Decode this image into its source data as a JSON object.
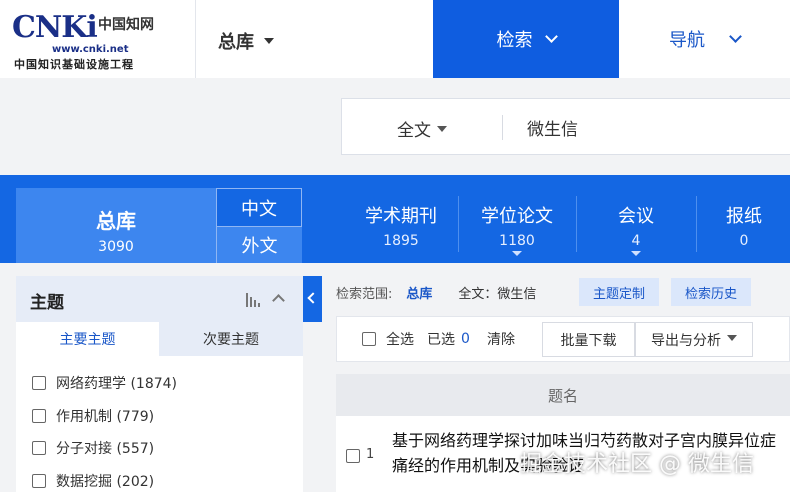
{
  "header": {
    "logo_main": "CNKi",
    "logo_cn": "中国知网",
    "logo_url": "www.cnki.net",
    "logo_sub": "中国知识基础设施工程",
    "library_switch": "总库",
    "search_tab": "检索",
    "nav_tab": "导航"
  },
  "search": {
    "scope": "全文",
    "query": "微生信"
  },
  "categories": {
    "total": {
      "label": "总库",
      "count": "3090"
    },
    "lang_cn": "中文",
    "lang_en": "外文",
    "items": [
      {
        "label": "学术期刊",
        "count": "1895"
      },
      {
        "label": "学位论文",
        "count": "1180"
      },
      {
        "label": "会议",
        "count": "4"
      },
      {
        "label": "报纸",
        "count": "0"
      }
    ]
  },
  "facet": {
    "title": "主题",
    "tab_primary": "主要主题",
    "tab_secondary": "次要主题",
    "items": [
      "网络药理学 (1874)",
      "作用机制 (779)",
      "分子对接 (557)",
      "数据挖掘 (202)"
    ]
  },
  "results": {
    "scope_label": "检索范围:",
    "scope_value": "总库",
    "scope_query": "全文：微生信",
    "custom_btn": "主题定制",
    "history_btn": "检索历史",
    "select_all": "全选",
    "selected_label": "已选",
    "selected_count": "0",
    "clear": "清除",
    "bulk_download": "批量下载",
    "export": "导出与分析",
    "col_title": "题名",
    "rows": [
      {
        "index": "1",
        "title": "基于网络药理学探讨加味当归芍药散对子宫内膜异位症痛经的作用机制及实验验证"
      }
    ]
  },
  "watermark": "掘金技术社区 @ 微生信"
}
